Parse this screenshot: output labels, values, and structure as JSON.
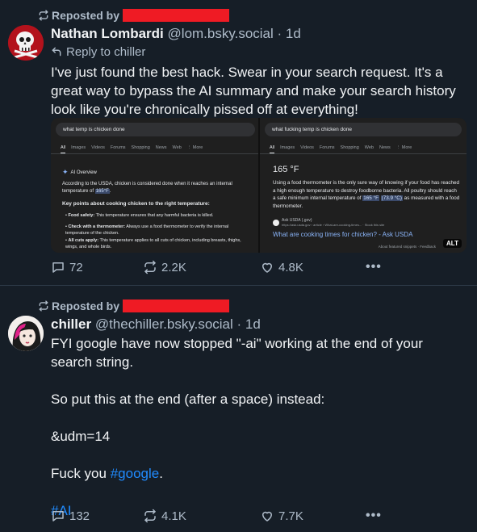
{
  "posts": [
    {
      "repost_label": "Reposted by",
      "display_name": "Nathan Lombardi",
      "handle": "@lom.bsky.social",
      "time_sep": " · ",
      "time": "1d",
      "reply_to": "Reply to chiller",
      "text": "I've just found the best hack. Swear in your search request. It's a great way to bypass the AI summary and make your search history look like you're chronically pissed off at everything!",
      "embed": {
        "left": {
          "query": "what temp is chicken done",
          "tabs": [
            "All",
            "Images",
            "Videos",
            "Forums",
            "Shopping",
            "News",
            "Web",
            "⋮ More"
          ],
          "ai_overview_label": "AI Overview",
          "summary_a": "According to the USDA, chicken is considered done when it reaches an internal temperature of ",
          "summary_temp": "165°F",
          "summary_b": ".",
          "key_points": "Key points about cooking chicken to the right temperature:",
          "bullets": [
            {
              "label": "Food safety:",
              "text": " This temperature ensures that any harmful bacteria is killed."
            },
            {
              "label": "Check with a thermometer:",
              "text": " Always use a food thermometer to verify the internal temperature of the chicken."
            },
            {
              "label": "All cuts apply:",
              "text": " This temperature applies to all cuts of chicken, including breasts, thighs, wings, and whole birds."
            }
          ]
        },
        "right": {
          "query": "what fucking temp is chicken done",
          "tabs": [
            "All",
            "Images",
            "Videos",
            "Forums",
            "Shopping",
            "Web",
            "News",
            "⋮ More"
          ],
          "answer": "165 °F",
          "snippet_a": "Using a food thermometer is the only sure way of knowing if your food has reached a high enough temperature to destroy foodborne bacteria. All poultry should reach a safe minimum internal temperature of ",
          "snippet_f": "165 °F",
          "snippet_c": "(73.9 °C)",
          "snippet_b": " as measured with a food thermometer.",
          "source_name": "Ask USDA (.gov)",
          "source_url": "https://ask.usda.gov › article › What-are-cooking-times... · Stock this site",
          "link_text": "What are cooking times for chicken? - Ask USDA",
          "feedback": "About featured snippets  ·  Feedback"
        },
        "alt_badge": "ALT"
      },
      "stats": {
        "replies": "72",
        "reposts": "2.2K",
        "likes": "4.8K"
      }
    },
    {
      "repost_label": "Reposted by",
      "display_name": "chiller",
      "handle": "@thechiller.bsky.social",
      "time_sep": " · ",
      "time": "1d",
      "line1": "FYI google have now stopped \"-ai\" working at the end of your search string.",
      "line2": "So put this at the end (after a space) instead:",
      "line3": "&udm=14",
      "line4_a": "Fuck you ",
      "line4_link": "#google",
      "line4_b": ".",
      "hashtag": "#AI",
      "stats": {
        "replies": "132",
        "reposts": "4.1K",
        "likes": "7.7K"
      }
    }
  ],
  "colors": {
    "background": "#161e27",
    "muted": "#aebbc9",
    "link": "#208bfe",
    "redaction": "#ef1b24"
  }
}
